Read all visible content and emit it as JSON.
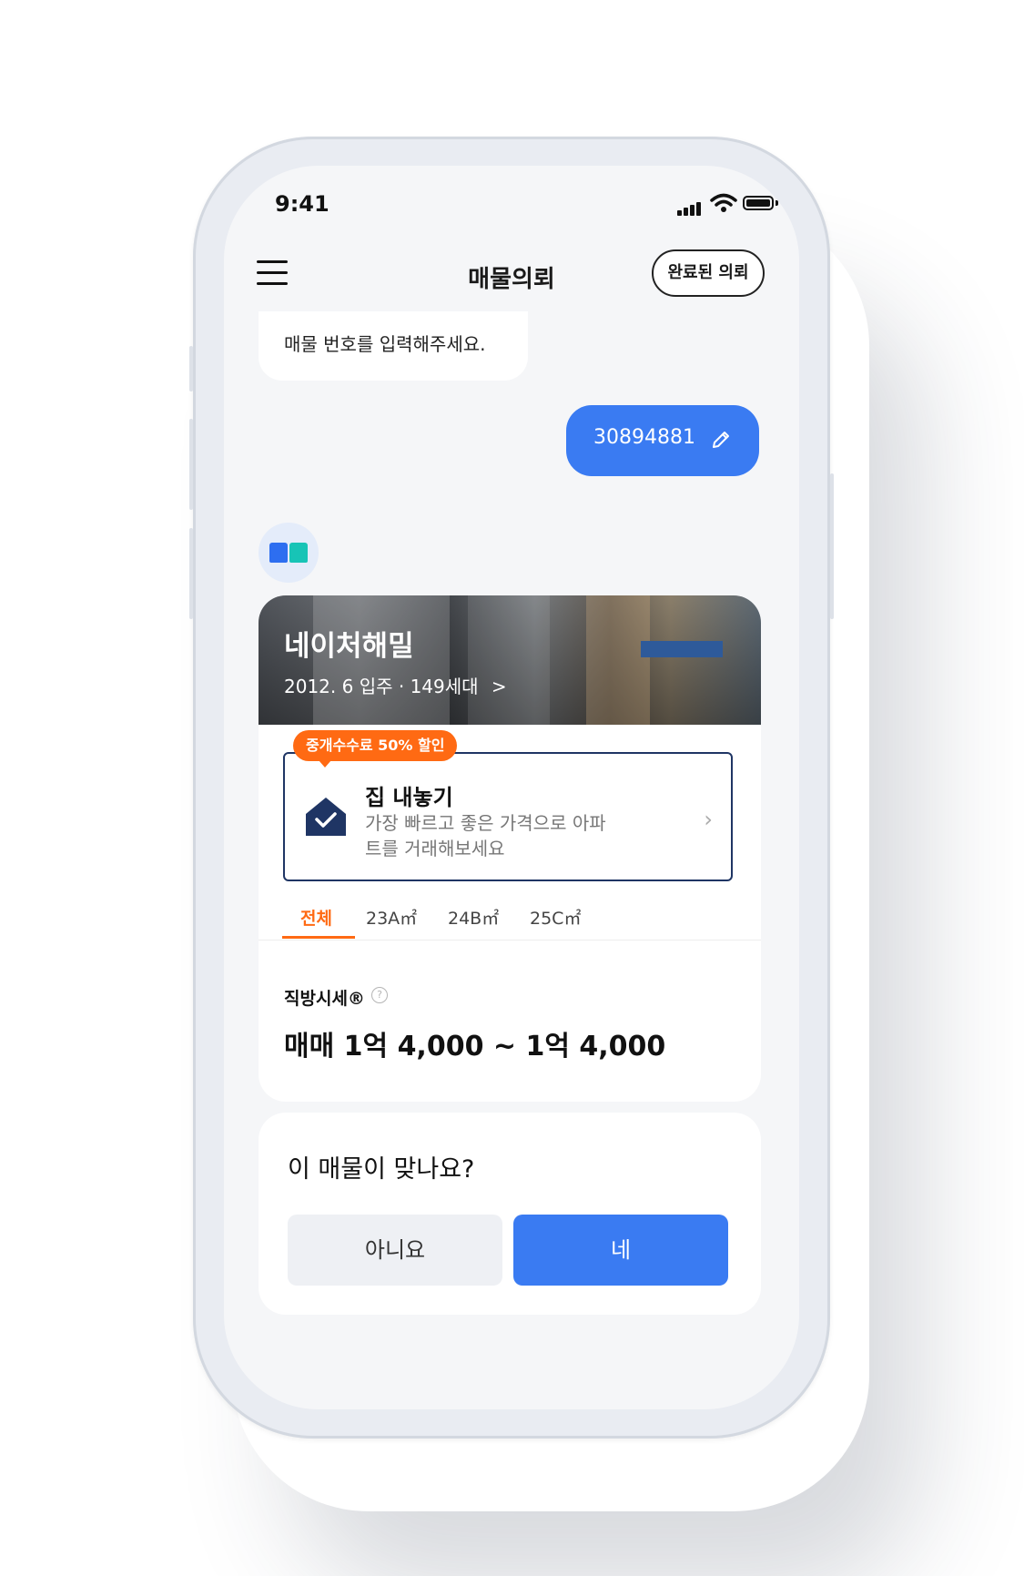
{
  "status_bar": {
    "time": "9:41"
  },
  "header": {
    "title": "매물의뢰",
    "done_label": "완료된 의뢰"
  },
  "chat": {
    "bot_message": "매물 번호를 입력해주세요.",
    "user_message": "30894881"
  },
  "property": {
    "name": "네이처해밀",
    "sub": "2012. 6 입주 · 149세대",
    "chevron": ">",
    "discount_tag": "중개수수료 50% 할인",
    "sell_title": "집 내놓기",
    "sell_desc": "가장 빠르고 좋은 가격으로 아파트를 거래해보세요",
    "tabs": [
      "전체",
      "23A㎡",
      "24B㎡",
      "25C㎡"
    ],
    "active_tab": "전체",
    "price_label": "직방시세®",
    "price_value": "매매 1억 4,000 ~ 1억 4,000"
  },
  "confirm": {
    "question": "이 매물이 맞나요?",
    "no_label": "아니요",
    "yes_label": "네"
  },
  "colors": {
    "accent_blue": "#3a7bf2",
    "accent_orange": "#ff6a13",
    "navy": "#1f3564",
    "background": "#f5f6f8"
  },
  "icons": [
    "menu-icon",
    "edit-icon",
    "house-check-icon",
    "chevron-right-icon",
    "help-icon",
    "signal-icon",
    "wifi-icon",
    "battery-icon"
  ]
}
